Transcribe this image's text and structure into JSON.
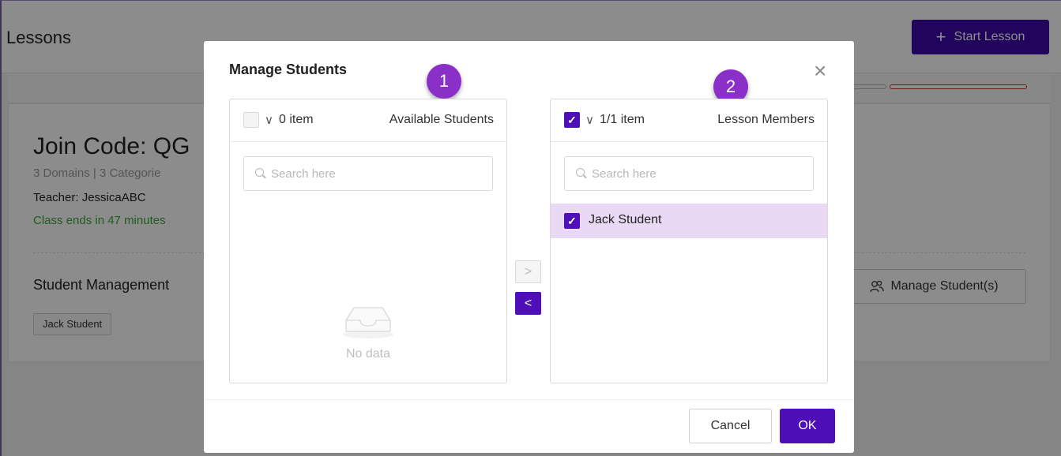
{
  "page": {
    "title": "Lessons",
    "start_button": "Start Lesson",
    "join_code": "Join Code: QG",
    "meta": "3 Domains  |  3 Categorie",
    "teacher": "Teacher:  JessicaABC",
    "class_ends": "Class ends in 47 minutes",
    "student_management_title": "Student Management",
    "student_tag": "Jack Student",
    "manage_button": "Manage Student(s)"
  },
  "modal": {
    "title": "Manage Students",
    "badge_left": "1",
    "badge_right": "2",
    "left_panel": {
      "count": "0 item",
      "title": "Available Students",
      "search_placeholder": "Search here",
      "empty_text": "No data"
    },
    "right_panel": {
      "count": "1/1 item",
      "title": "Lesson Members",
      "search_placeholder": "Search here",
      "items": [
        {
          "label": "Jack Student",
          "checked": true
        }
      ]
    },
    "cancel": "Cancel",
    "ok": "OK"
  },
  "colors": {
    "primary": "#4e0fb8",
    "badge": "#8b2fc9",
    "selected_row": "#e9d9f4",
    "success_text": "#3aa93a"
  },
  "icons": {
    "plus": "plus-icon",
    "close": "close-icon",
    "chevron": "chevron-down-icon",
    "search": "search-icon",
    "inbox": "empty-inbox-icon",
    "users": "users-icon",
    "arrow_right": "chevron-right-icon",
    "arrow_left": "chevron-left-icon",
    "check": "check-icon"
  }
}
